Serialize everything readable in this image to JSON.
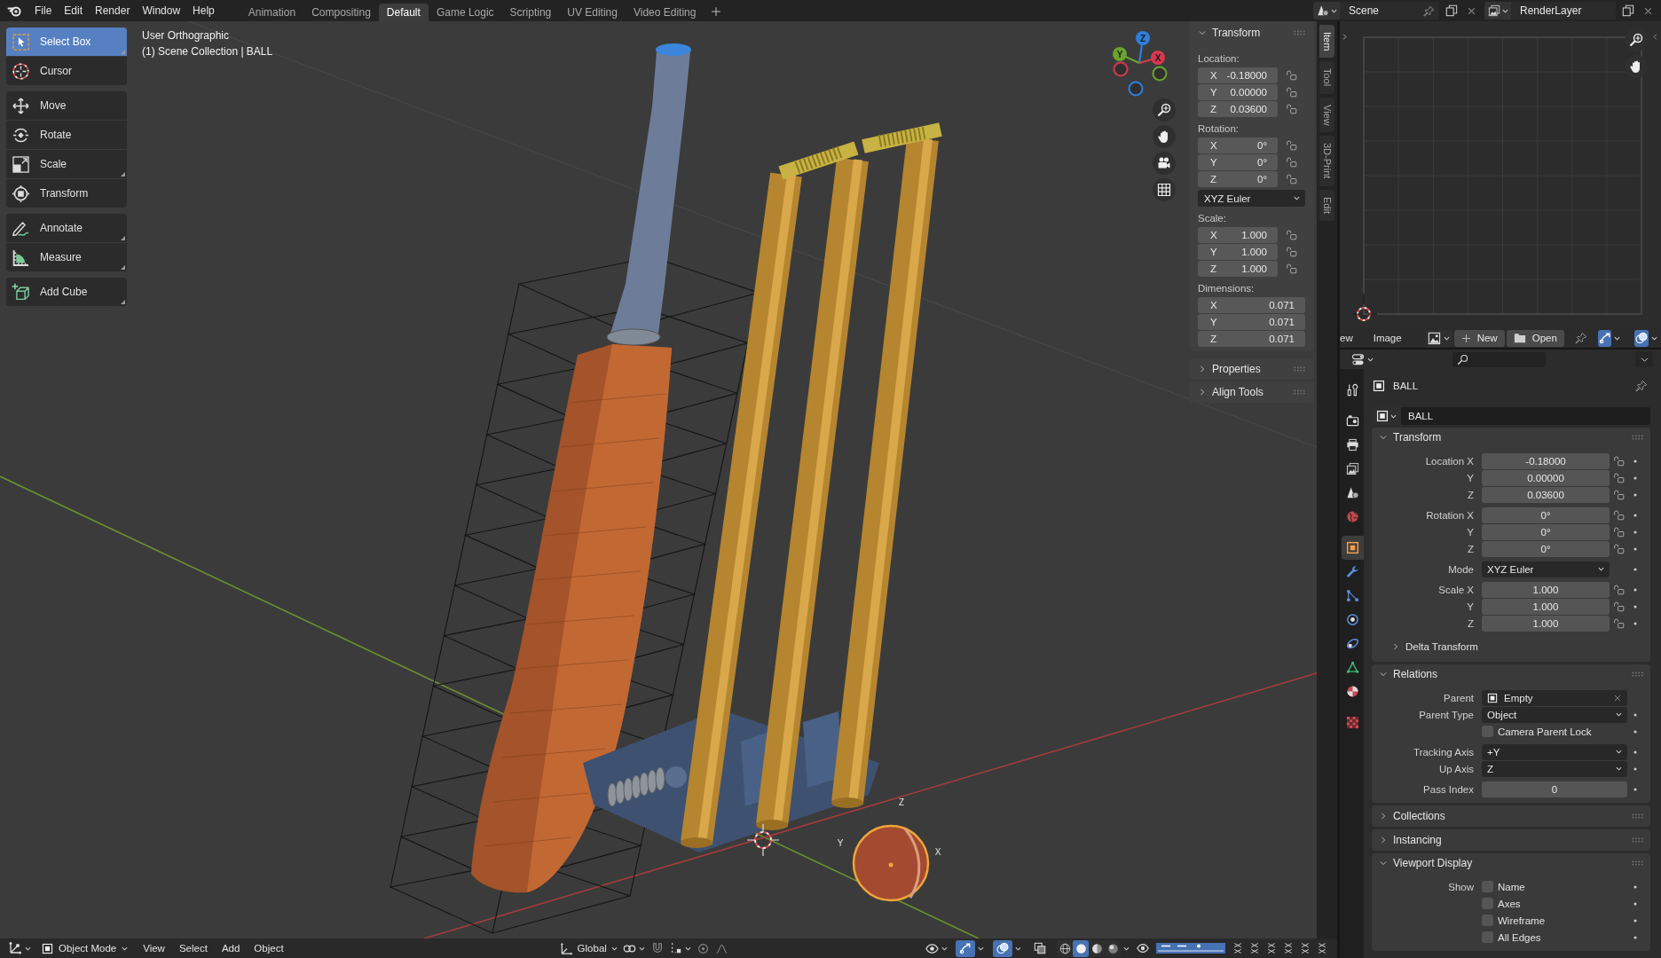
{
  "top_bar": {
    "menus": [
      "File",
      "Edit",
      "Render",
      "Window",
      "Help"
    ],
    "workspaces": [
      {
        "label": "Animation",
        "selected": false
      },
      {
        "label": "Compositing",
        "selected": false
      },
      {
        "label": "Default",
        "selected": true
      },
      {
        "label": "Game Logic",
        "selected": false
      },
      {
        "label": "Scripting",
        "selected": false
      },
      {
        "label": "UV Editing",
        "selected": false
      },
      {
        "label": "Video Editing",
        "selected": false
      }
    ],
    "scene": "Scene",
    "view_layer": "RenderLayer"
  },
  "viewport": {
    "view_name": "User Orthographic",
    "collection_info": "(1) Scene Collection | BALL",
    "toolbar": [
      [
        {
          "label": "Select Box",
          "selected": true,
          "more_tools": true
        },
        {
          "label": "Cursor",
          "selected": false,
          "more_tools": false
        }
      ],
      [
        {
          "label": "Move",
          "selected": false,
          "more_tools": false
        },
        {
          "label": "Rotate",
          "selected": false,
          "more_tools": false
        },
        {
          "label": "Scale",
          "selected": false,
          "more_tools": true
        },
        {
          "label": "Transform",
          "selected": false,
          "more_tools": false
        }
      ],
      [
        {
          "label": "Annotate",
          "selected": false,
          "more_tools": true
        },
        {
          "label": "Measure",
          "selected": false,
          "more_tools": true
        }
      ],
      [
        {
          "label": "Add Cube",
          "selected": false,
          "more_tools": true
        }
      ]
    ],
    "gizmo_axes": [
      {
        "label": "Z",
        "color": "#2e7fdc"
      },
      {
        "label": "Y",
        "color": "#6ba32e"
      },
      {
        "label": "X",
        "color": "#d8384e"
      }
    ],
    "object_axes": [
      "Y",
      "Z",
      "X"
    ]
  },
  "sidebar": {
    "tabs": [
      {
        "label": "Item",
        "selected": true
      },
      {
        "label": "Tool",
        "selected": false
      },
      {
        "label": "View",
        "selected": false
      },
      {
        "label": "3D-Print",
        "selected": false
      },
      {
        "label": "Edit",
        "selected": false
      }
    ],
    "transform": {
      "title": "Transform",
      "expanded": true,
      "groups": [
        {
          "label": "Location:",
          "fields": [
            {
              "axis": "X",
              "value": "-0.18000",
              "locked": false
            },
            {
              "axis": "Y",
              "value": "0.00000",
              "locked": false
            },
            {
              "axis": "Z",
              "value": "0.03600",
              "locked": false
            }
          ]
        },
        {
          "label": "Rotation:",
          "fields": [
            {
              "axis": "X",
              "value": "0°",
              "locked": false
            },
            {
              "axis": "Y",
              "value": "0°",
              "locked": false
            },
            {
              "axis": "Z",
              "value": "0°",
              "locked": false
            }
          ],
          "mode": "XYZ Euler"
        },
        {
          "label": "Scale:",
          "fields": [
            {
              "axis": "X",
              "value": "1.000",
              "locked": false
            },
            {
              "axis": "Y",
              "value": "1.000",
              "locked": false
            },
            {
              "axis": "Z",
              "value": "1.000",
              "locked": false
            }
          ]
        },
        {
          "label": "Dimensions:",
          "fields": [
            {
              "axis": "X",
              "value": "0.071"
            },
            {
              "axis": "Y",
              "value": "0.071"
            },
            {
              "axis": "Z",
              "value": "0.071"
            }
          ]
        }
      ]
    },
    "panels": [
      {
        "title": "Properties",
        "expanded": false
      },
      {
        "title": "Align Tools",
        "expanded": false
      }
    ]
  },
  "image_editor": {
    "menus": [
      "ew",
      "Image"
    ],
    "new_label": "New",
    "open_label": "Open",
    "toggles": [
      {
        "on": true
      },
      {
        "on": true
      }
    ]
  },
  "properties": {
    "tabs": [
      [
        {
          "selected": false
        }
      ],
      [
        {
          "selected": false
        },
        {
          "selected": false
        },
        {
          "selected": false
        },
        {
          "selected": false
        },
        {
          "selected": false
        }
      ],
      [
        {
          "selected": true
        },
        {
          "selected": false
        },
        {
          "selected": false
        },
        {
          "selected": false
        },
        {
          "selected": false
        },
        {
          "selected": false
        },
        {
          "selected": false
        }
      ],
      [
        {
          "selected": false
        }
      ]
    ],
    "object_name": "BALL",
    "name_field": "BALL",
    "panels": [
      {
        "title": "Transform",
        "expanded": true,
        "groups": [
          [
            {
              "kind": "number",
              "label": "Location X",
              "value": "-0.18000",
              "locked": false,
              "animatable": true
            },
            {
              "kind": "number",
              "label": "Y",
              "value": "0.00000",
              "locked": false,
              "animatable": true
            },
            {
              "kind": "number",
              "label": "Z",
              "value": "0.03600",
              "locked": false,
              "animatable": true
            }
          ],
          [
            {
              "kind": "number",
              "label": "Rotation X",
              "value": "0°",
              "locked": false,
              "animatable": true
            },
            {
              "kind": "number",
              "label": "Y",
              "value": "0°",
              "locked": false,
              "animatable": true
            },
            {
              "kind": "number",
              "label": "Z",
              "value": "0°",
              "locked": false,
              "animatable": true
            }
          ],
          [
            {
              "kind": "dropdown",
              "label": "Mode",
              "value": "XYZ Euler",
              "animatable": true
            }
          ],
          [
            {
              "kind": "number",
              "label": "Scale X",
              "value": "1.000",
              "locked": false,
              "animatable": true
            },
            {
              "kind": "number",
              "label": "Y",
              "value": "1.000",
              "locked": false,
              "animatable": true
            },
            {
              "kind": "number",
              "label": "Z",
              "value": "1.000",
              "locked": false,
              "animatable": true
            }
          ]
        ],
        "subpanels": [
          {
            "title": "Delta Transform",
            "expanded": false
          }
        ]
      },
      {
        "title": "Relations",
        "expanded": true,
        "groups": [
          [
            {
              "kind": "object",
              "label": "Parent",
              "value": "Empty",
              "animatable": false
            },
            {
              "kind": "dropdown",
              "label": "Parent Type",
              "value": "Object",
              "animatable": true
            },
            {
              "kind": "checkbox",
              "text": "Camera Parent Lock",
              "checked": false,
              "animatable": true
            }
          ],
          [
            {
              "kind": "dropdown",
              "label": "Tracking Axis",
              "value": "+Y",
              "animatable": true
            },
            {
              "kind": "dropdown",
              "label": "Up Axis",
              "value": "Z",
              "animatable": true
            }
          ],
          [
            {
              "kind": "number",
              "label": "Pass Index",
              "value": "0",
              "animatable": true
            }
          ]
        ]
      },
      {
        "title": "Collections",
        "expanded": false
      },
      {
        "title": "Instancing",
        "expanded": false
      },
      {
        "title": "Viewport Display",
        "expanded": true,
        "groups": [
          [
            {
              "kind": "checkbox",
              "label": "Show",
              "text": "Name",
              "checked": false,
              "animatable": true
            },
            {
              "kind": "checkbox",
              "text": "Axes",
              "checked": false,
              "animatable": true
            },
            {
              "kind": "checkbox",
              "text": "Wireframe",
              "checked": false,
              "animatable": true
            },
            {
              "kind": "checkbox",
              "text": "All Edges",
              "checked": false,
              "animatable": true
            }
          ]
        ]
      }
    ]
  },
  "header": {
    "mode": "Object Mode",
    "menus": [
      "View",
      "Select",
      "Add",
      "Object"
    ],
    "orientation": "Global",
    "toggles": [
      {
        "on": true
      },
      {
        "on": true
      },
      {
        "on": false
      }
    ],
    "shading": [
      {
        "selected": false
      },
      {
        "selected": true
      },
      {
        "selected": false
      },
      {
        "selected": false
      }
    ]
  }
}
